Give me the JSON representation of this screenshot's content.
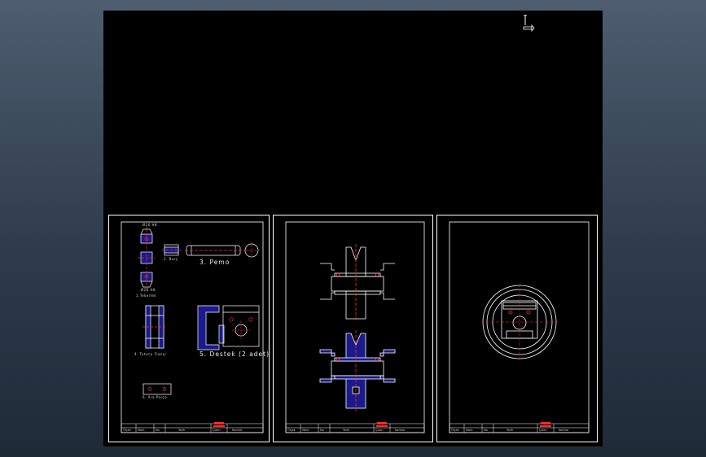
{
  "sheet1": {
    "labels": {
      "part1": "1.Tekerlek",
      "part2": "2. Burç",
      "part3": "3. Pemo",
      "part4": "4. Tutucu Flanşı",
      "part5": "5. Destek (2 adet)",
      "part6": "6. Ara Parça",
      "dim_top": "Ø26 H8",
      "dim_bottom": "Ø26 H8"
    }
  },
  "title_block": {
    "cells": [
      "Ölçek",
      "Malz.",
      "No",
      "Tarih",
      "Çizen",
      "Kontrol"
    ]
  },
  "colors": {
    "background": "#000000",
    "line": "#ffffff",
    "hatch": "#1a1a8c",
    "accent": "#ff2a2a",
    "surround": "#2d3b4c"
  }
}
